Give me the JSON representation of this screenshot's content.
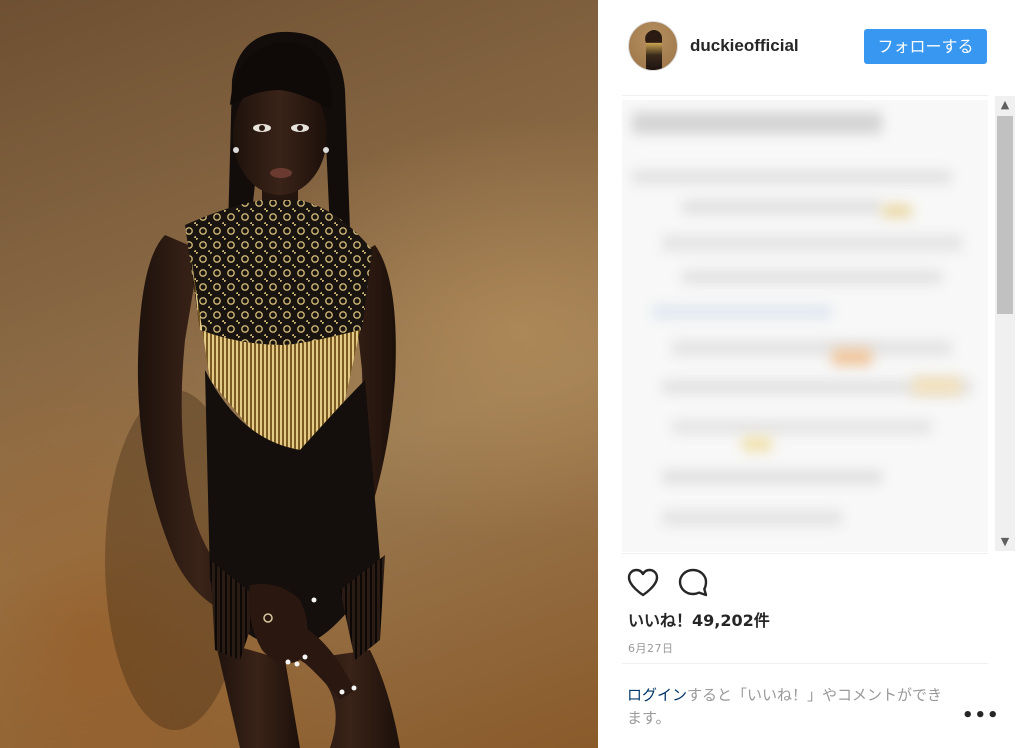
{
  "post": {
    "image_alt": "",
    "header": {
      "username": "duckieofficial",
      "follow_label": "フォローする"
    },
    "likes_label": "いいね！49,202件",
    "date": "6月27日",
    "login_prompt": {
      "link": "ログイン",
      "rest": "すると「いいね！」やコメントができます。"
    },
    "more_label": "•••",
    "icons": [
      "heart-icon",
      "comment-icon",
      "more-options-icon",
      "scroll-up-arrow",
      "scroll-down-arrow"
    ]
  },
  "colors": {
    "follow_button": "#3897f0",
    "link": "#003569",
    "muted_text": "#999999",
    "divider": "#efefef"
  }
}
